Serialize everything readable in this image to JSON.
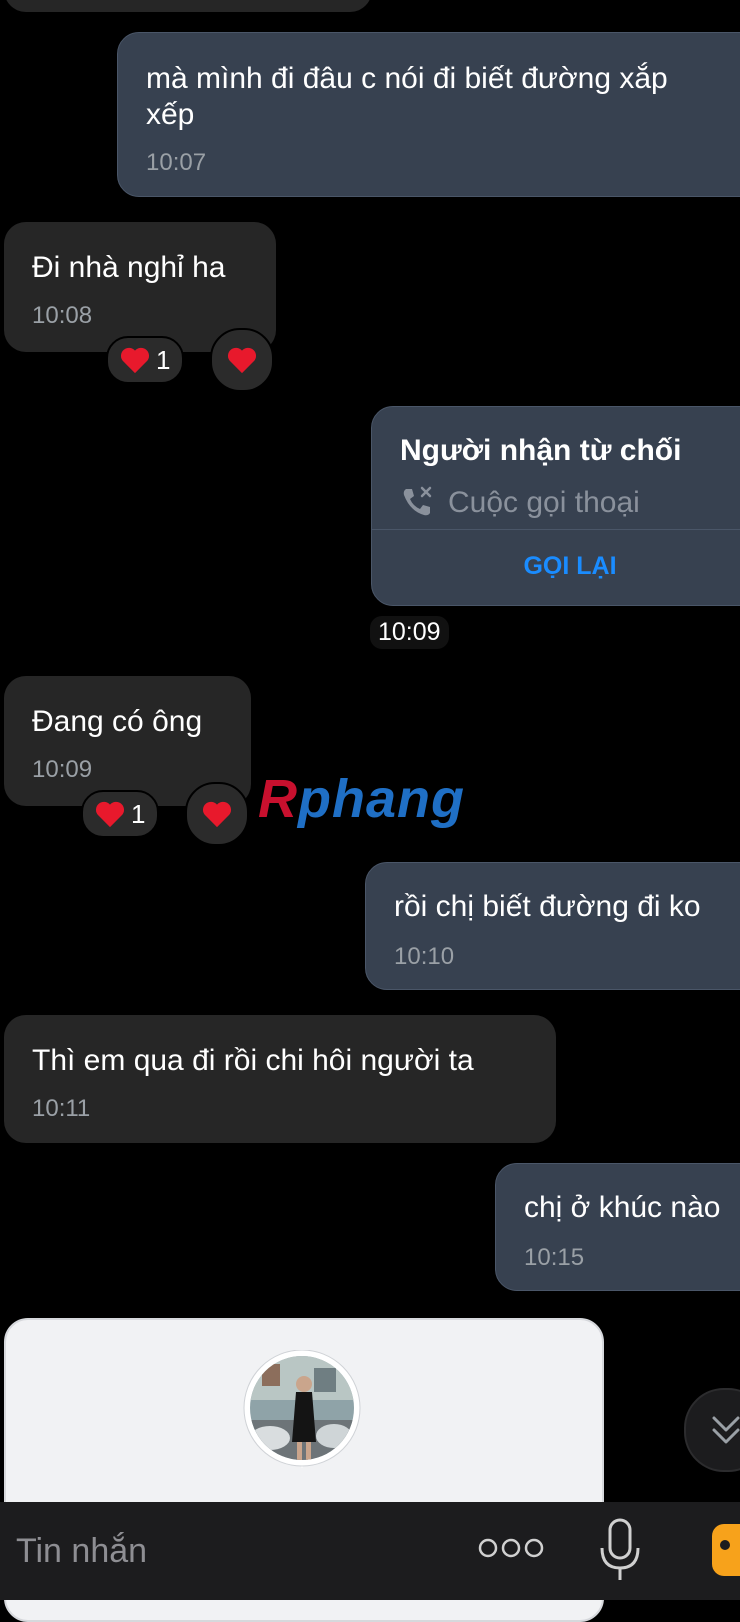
{
  "messages": [
    {
      "id": "m1",
      "direction": "sent",
      "text_line1": "mà mình đi đâu c nói đi biết đường xắp",
      "text_line2": "xếp",
      "time": "10:07"
    },
    {
      "id": "m2",
      "direction": "received",
      "text": "Đi nhà nghỉ ha",
      "time": "10:08",
      "reaction_count": "1"
    },
    {
      "id": "m3",
      "direction": "sent",
      "type": "call",
      "title": "Người nhận từ chối",
      "subtitle": "Cuộc gọi thoại",
      "action": "GỌI LẠI",
      "time": "10:09"
    },
    {
      "id": "m4",
      "direction": "received",
      "text": "Đang có ông",
      "time": "10:09",
      "reaction_count": "1"
    },
    {
      "id": "m5",
      "direction": "sent",
      "text": "rồi chị biết đường đi ko",
      "time": "10:10"
    },
    {
      "id": "m6",
      "direction": "received",
      "text": "Thì em qua đi rồi chi hôi người ta",
      "time": "10:11"
    },
    {
      "id": "m7",
      "direction": "sent",
      "text": "chị ở khúc nào",
      "time": "10:15"
    }
  ],
  "watermark": {
    "first": "R",
    "rest": "phang"
  },
  "composer": {
    "placeholder": "Tin nhắn"
  },
  "icons": {
    "heart": "heart-icon",
    "call_declined": "phone-declined-icon",
    "more": "more-dots-icon",
    "mic": "microphone-icon",
    "sticker": "sticker-icon",
    "scroll_down": "chevron-down-icon"
  },
  "colors": {
    "accent_link": "#1a8cff",
    "sent_bubble": "#374150",
    "received_bubble": "#262626",
    "heart": "#e8192c"
  }
}
